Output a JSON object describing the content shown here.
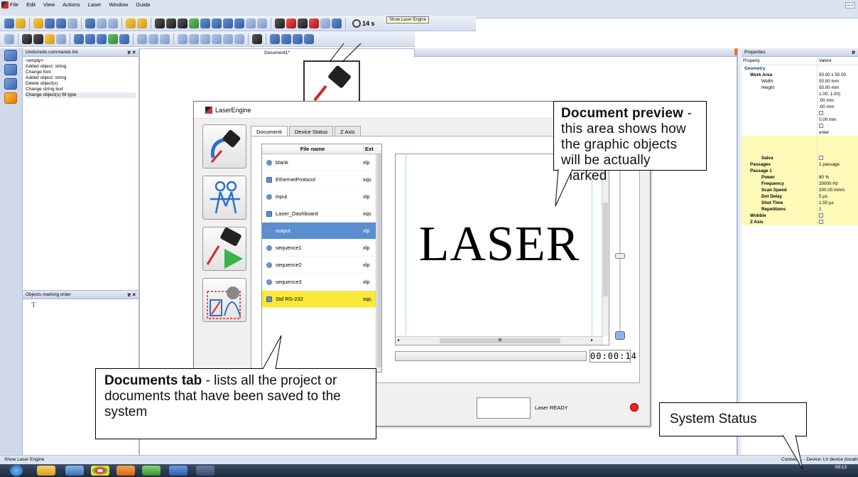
{
  "menu": {
    "items": [
      "File",
      "Edit",
      "View",
      "Actions",
      "Laser",
      "Window",
      "Guida"
    ]
  },
  "toolbar": {
    "timer": "14 s",
    "tooltip": "Show Laser Engine"
  },
  "undo_pane": {
    "title": "Undo/redo commands list",
    "items": [
      "<empty>",
      "Added object: string",
      "Change font",
      "Added object: string",
      "Delete object(s)",
      "Change string text",
      "Change object(s) fill type"
    ]
  },
  "order_pane": {
    "title": "Objects marking order",
    "item_glyph": "T"
  },
  "doc_tab": {
    "label": "Document1*"
  },
  "properties": {
    "title": "Properties",
    "col_property": "Property",
    "col_value": "Valore",
    "rows": [
      {
        "k": "Geometry",
        "v": "",
        "lvl": 0,
        "bold": true,
        "yellow": false,
        "cb": false
      },
      {
        "k": "Work Area",
        "v": "50.00 x 50.00",
        "lvl": 1,
        "bold": true,
        "yellow": false,
        "cb": false
      },
      {
        "k": "Width",
        "v": "50.00 mm",
        "lvl": 2,
        "bold": false,
        "yellow": false,
        "cb": false
      },
      {
        "k": "Height",
        "v": "50.00 mm",
        "lvl": 2,
        "bold": false,
        "yellow": false,
        "cb": false
      },
      {
        "k": "",
        "v": "1.00, 1.00)",
        "lvl": 2,
        "bold": false,
        "yellow": false,
        "cb": false
      },
      {
        "k": "",
        "v": ".00 mm",
        "lvl": 2,
        "bold": false,
        "yellow": false,
        "cb": false
      },
      {
        "k": "",
        "v": ".00 mm",
        "lvl": 2,
        "bold": false,
        "yellow": false,
        "cb": false
      },
      {
        "k": "",
        "v": "",
        "lvl": 2,
        "bold": false,
        "yellow": false,
        "cb": true
      },
      {
        "k": "",
        "v": "0.00 mm",
        "lvl": 2,
        "bold": false,
        "yellow": false,
        "cb": false
      },
      {
        "k": "",
        "v": "",
        "lvl": 2,
        "bold": false,
        "yellow": false,
        "cb": true
      },
      {
        "k": "",
        "v": "enter",
        "lvl": 2,
        "bold": false,
        "yellow": false,
        "cb": false
      },
      {
        "k": "",
        "v": "",
        "lvl": 2,
        "bold": false,
        "yellow": true,
        "cb": false
      },
      {
        "k": "",
        "v": "",
        "lvl": 2,
        "bold": false,
        "yellow": true,
        "cb": false
      },
      {
        "k": "",
        "v": "",
        "lvl": 2,
        "bold": false,
        "yellow": true,
        "cb": false
      },
      {
        "k": "Salva",
        "v": "",
        "lvl": 2,
        "bold": true,
        "yellow": true,
        "cb": true
      },
      {
        "k": "Passages",
        "v": "1 passage",
        "lvl": 1,
        "bold": true,
        "yellow": true,
        "cb": false
      },
      {
        "k": "Passage 1",
        "v": "",
        "lvl": 1,
        "bold": true,
        "yellow": true,
        "cb": false
      },
      {
        "k": "Power",
        "v": "80 %",
        "lvl": 2,
        "bold": true,
        "yellow": true,
        "cb": false
      },
      {
        "k": "Frequency",
        "v": "20000 Hz",
        "lvl": 2,
        "bold": true,
        "yellow": true,
        "cb": false
      },
      {
        "k": "Scan Speed",
        "v": "200.00 mm/s",
        "lvl": 2,
        "bold": true,
        "yellow": true,
        "cb": false
      },
      {
        "k": "Dot Delay",
        "v": "5 µs",
        "lvl": 2,
        "bold": true,
        "yellow": true,
        "cb": false
      },
      {
        "k": "Shot Time",
        "v": "1.50 µs",
        "lvl": 2,
        "bold": true,
        "yellow": true,
        "cb": false
      },
      {
        "k": "Repetitions",
        "v": "1",
        "lvl": 2,
        "bold": true,
        "yellow": true,
        "cb": false
      },
      {
        "k": "Wobble",
        "v": "",
        "lvl": 1,
        "bold": true,
        "yellow": true,
        "cb": true
      },
      {
        "k": "Z Axis",
        "v": "",
        "lvl": 1,
        "bold": true,
        "yellow": true,
        "cb": true
      }
    ]
  },
  "laser_engine": {
    "title": "LaserEngine",
    "tabs": [
      "Documenti",
      "Device Status",
      "Z Axis"
    ],
    "file_header": {
      "name": "File name",
      "ext": "Ext"
    },
    "files": [
      {
        "name": "blank",
        "ext": "xlp",
        "kind": "doc",
        "state": ""
      },
      {
        "name": "EthernetProtocol",
        "ext": "xqs",
        "kind": "seq",
        "state": ""
      },
      {
        "name": "input",
        "ext": "xlp",
        "kind": "doc",
        "state": ""
      },
      {
        "name": "Laser_Dashboard",
        "ext": "xqs",
        "kind": "seq",
        "state": ""
      },
      {
        "name": "output",
        "ext": "xlp",
        "kind": "doc",
        "state": "selected"
      },
      {
        "name": "sequence1",
        "ext": "xlp",
        "kind": "doc",
        "state": ""
      },
      {
        "name": "sequence2",
        "ext": "xlp",
        "kind": "doc",
        "state": ""
      },
      {
        "name": "sequence3",
        "ext": "xlp",
        "kind": "doc",
        "state": ""
      },
      {
        "name": "Std RS-232",
        "ext": "xqs",
        "kind": "seq",
        "state": "highlight"
      }
    ],
    "preview_text": "LASER",
    "hscroll_grip": "III",
    "timer_display": "00:00:14",
    "status": "Laser READY"
  },
  "callouts": {
    "preview": {
      "bold": "Document preview",
      "text": " - this area shows how the graphic objects will be actually marked"
    },
    "documents": {
      "bold": "Documents tab",
      "text": " - lists all the project or documents that have been saved to the system"
    },
    "system": {
      "text": "System Status"
    }
  },
  "statusbar": {
    "left": "Show Laser Engine",
    "right": "Connect... - Device: LV device (localho"
  },
  "taskbar": {
    "time": "09:13"
  }
}
